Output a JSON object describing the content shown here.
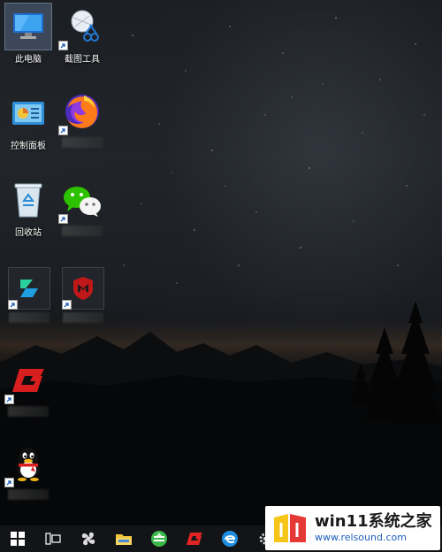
{
  "desktop": {
    "icons": [
      {
        "name": "this-pc",
        "label": "此电脑"
      },
      {
        "name": "snipping-tool",
        "label": "截图工具"
      },
      {
        "name": "control-panel",
        "label": "控制面板"
      },
      {
        "name": "firefox",
        "label": ""
      },
      {
        "name": "recycle-bin",
        "label": "回收站"
      },
      {
        "name": "wechat",
        "label": ""
      },
      {
        "name": "green-app",
        "label": ""
      },
      {
        "name": "mcafee",
        "label": ""
      },
      {
        "name": "g-app",
        "label": ""
      },
      {
        "name": "qq",
        "label": ""
      }
    ]
  },
  "taskbar": {
    "buttons": [
      "start",
      "task-view",
      "fan-app",
      "file-explorer",
      "green-browser",
      "red-app",
      "edge",
      "settings"
    ]
  },
  "watermark": {
    "title": "win11系统之家",
    "url": "www.relsound.com"
  },
  "colors": {
    "taskbar": "#121417",
    "start_blue": "#2f8fe0",
    "watermark_blue": "#1f5fbf"
  }
}
